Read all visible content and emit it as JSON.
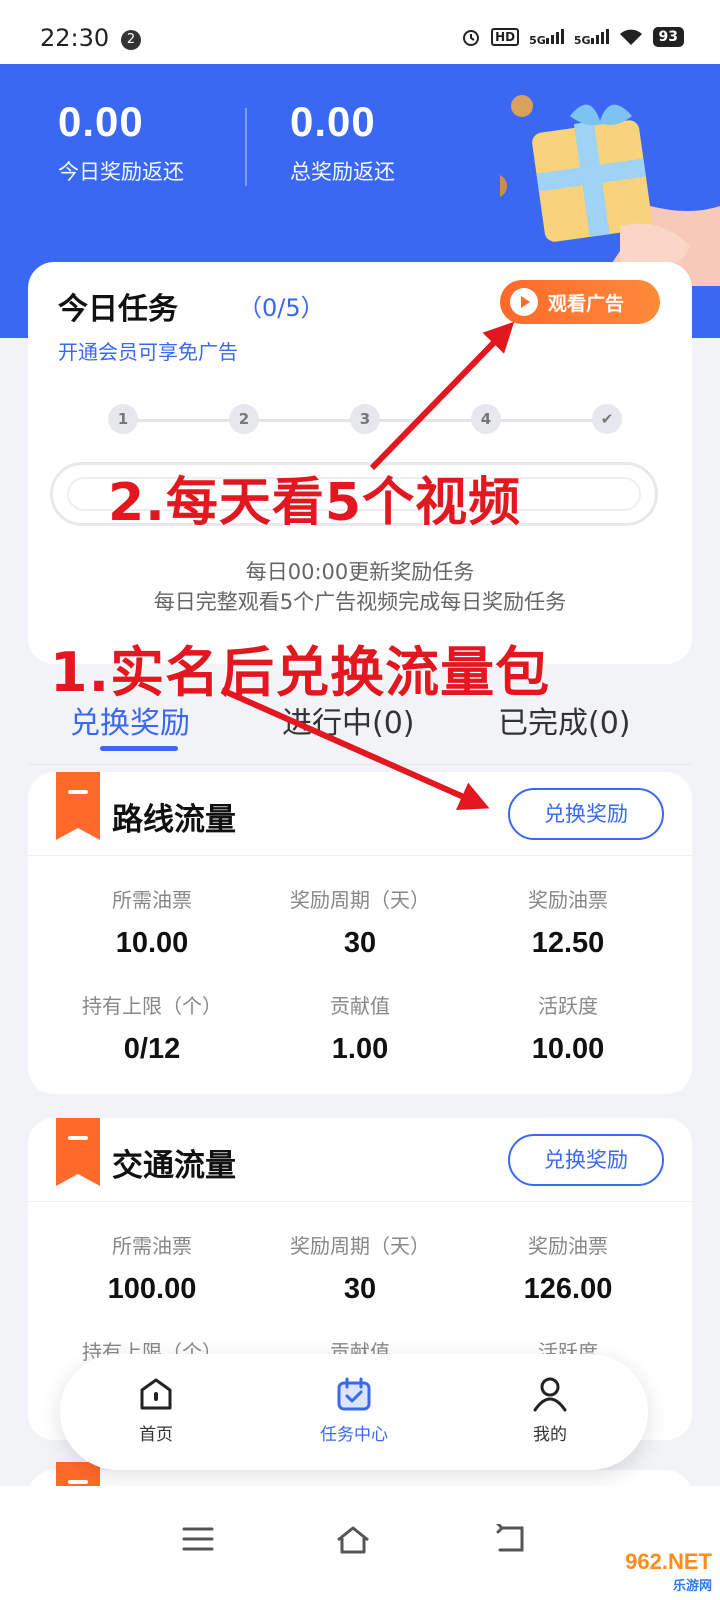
{
  "status_bar": {
    "time": "22:30",
    "notification_count": "2",
    "network_hd": "HD",
    "signal1": "5G",
    "signal2": "5G",
    "battery": "93"
  },
  "header": {
    "today_reward": {
      "value": "0.00",
      "label": "今日奖励返还"
    },
    "total_reward": {
      "value": "0.00",
      "label": "总奖励返还"
    }
  },
  "task_card": {
    "title": "今日任务",
    "progress": "（0/5）",
    "vip_link": "开通会员可享免广告",
    "watch_ad_button": "观看广告",
    "steps": [
      "1",
      "2",
      "3",
      "4",
      "✔"
    ],
    "update_note": "每日00:00更新奖励任务",
    "rule_note": "每日完整观看5个广告视频完成每日奖励任务"
  },
  "annotations": {
    "step2": "2.每天看5个视频",
    "step1": "1.实名后兑换流量包"
  },
  "tabs": [
    "兑换奖励",
    "进行中(0)",
    "已完成(0)"
  ],
  "reward_cards": [
    {
      "title": "路线流量",
      "button": "兑换奖励",
      "fields": [
        {
          "label": "所需油票",
          "value": "10.00"
        },
        {
          "label": "奖励周期（天）",
          "value": "30"
        },
        {
          "label": "奖励油票",
          "value": "12.50"
        },
        {
          "label": "持有上限（个）",
          "value": "0/12"
        },
        {
          "label": "贡献值",
          "value": "1.00"
        },
        {
          "label": "活跃度",
          "value": "10.00"
        }
      ]
    },
    {
      "title": "交通流量",
      "button": "兑换奖励",
      "fields": [
        {
          "label": "所需油票",
          "value": "100.00"
        },
        {
          "label": "奖励周期（天）",
          "value": "30"
        },
        {
          "label": "奖励油票",
          "value": "126.00"
        },
        {
          "label": "持有上限（个）",
          "value": ""
        },
        {
          "label": "贡献值",
          "value": ""
        },
        {
          "label": "活跃度",
          "value": ""
        }
      ]
    }
  ],
  "bottom_nav": [
    {
      "label": "首页",
      "icon": "home-icon"
    },
    {
      "label": "任务中心",
      "icon": "calendar-check-icon"
    },
    {
      "label": "我的",
      "icon": "user-icon"
    }
  ],
  "watermark": {
    "text": "962.NET",
    "sub": "乐游网"
  },
  "colors": {
    "primary": "#3a68f2",
    "accent": "#ff6a2a",
    "annotation": "#e3171f"
  }
}
